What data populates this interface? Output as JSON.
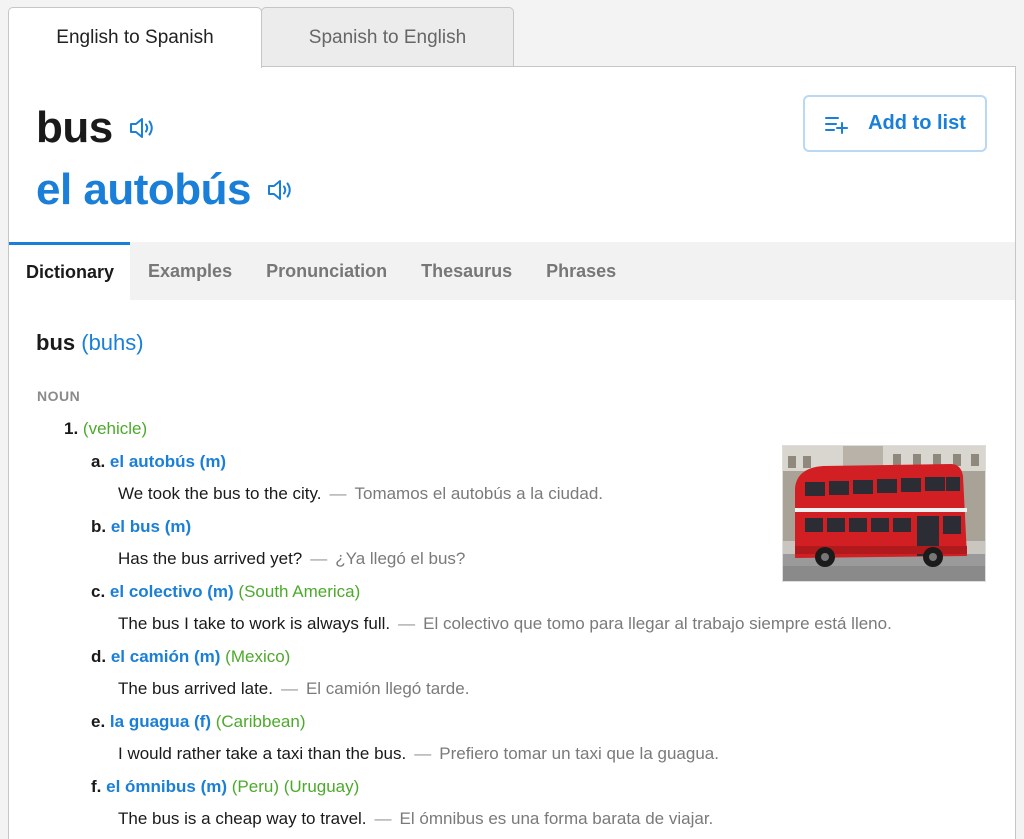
{
  "lang_tabs": {
    "active": "English to Spanish",
    "inactive": "Spanish to English"
  },
  "headword": "bus",
  "translation": "el autobús",
  "add_to_list": "Add to list",
  "sub_tabs": [
    "Dictionary",
    "Examples",
    "Pronunciation",
    "Thesaurus",
    "Phrases"
  ],
  "entry": {
    "word": "bus",
    "phonetic": "(buhs)"
  },
  "part_of_speech": "NOUN",
  "sense": {
    "number": "1.",
    "context": "(vehicle)"
  },
  "translations": [
    {
      "letter": "a.",
      "word": "el autobús (m)",
      "region": "",
      "example_en": "We took the bus to the city.",
      "example_es": "Tomamos el autobús a la ciudad."
    },
    {
      "letter": "b.",
      "word": "el bus (m)",
      "region": "",
      "example_en": "Has the bus arrived yet?",
      "example_es": "¿Ya llegó el bus?"
    },
    {
      "letter": "c.",
      "word": "el colectivo (m)",
      "region": "(South America)",
      "example_en": "The bus I take to work is always full.",
      "example_es": "El colectivo que tomo para llegar al trabajo siempre está lleno."
    },
    {
      "letter": "d.",
      "word": "el camión (m)",
      "region": "(Mexico)",
      "example_en": "The bus arrived late.",
      "example_es": "El camión llegó tarde."
    },
    {
      "letter": "e.",
      "word": "la guagua (f)",
      "region": "(Caribbean)",
      "example_en": "I would rather take a taxi than the bus.",
      "example_es": "Prefiero tomar un taxi que la guagua."
    },
    {
      "letter": "f.",
      "word": "el ómnibus (m)",
      "region": "(Peru) (Uruguay)",
      "example_en": "The bus is a cheap way to travel.",
      "example_es": "El ómnibus es una forma barata de viajar."
    }
  ],
  "dash": "—",
  "colors": {
    "accent": "#1a7fd8",
    "region": "#4caa2b",
    "muted": "#7a7a7a"
  }
}
